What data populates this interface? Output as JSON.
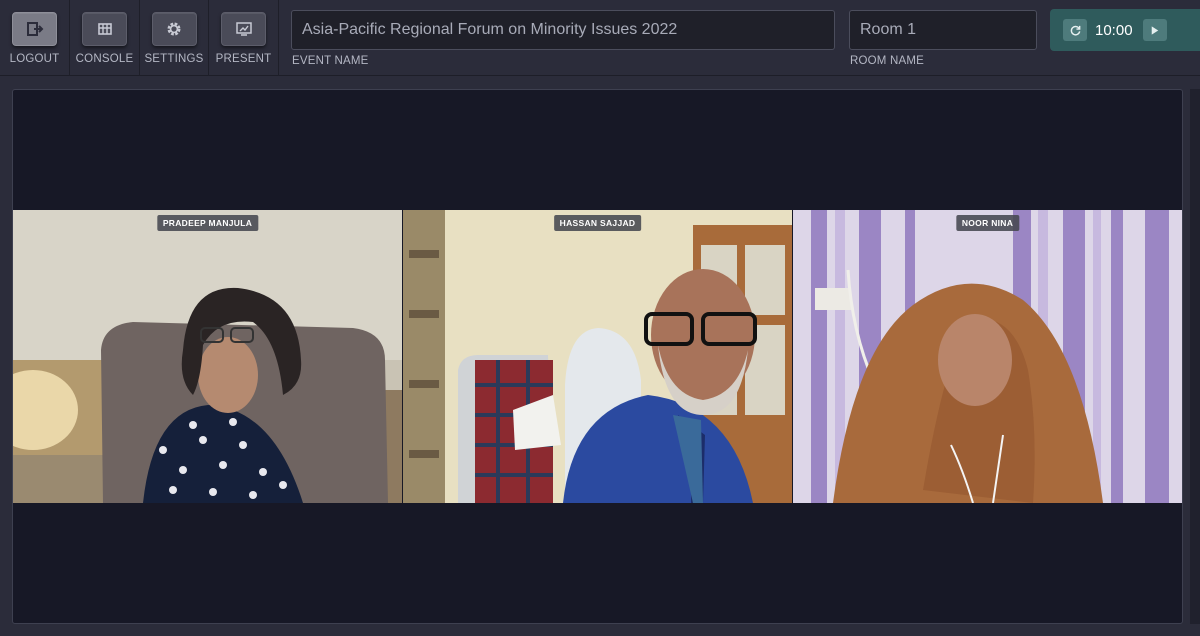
{
  "toolbar": {
    "buttons": [
      {
        "label": "LOGOUT",
        "icon": "logout-icon"
      },
      {
        "label": "CONSOLE",
        "icon": "grid-icon"
      },
      {
        "label": "SETTINGS",
        "icon": "gear-icon"
      },
      {
        "label": "PRESENT",
        "icon": "present-icon"
      }
    ],
    "event_name": {
      "value": "Asia-Pacific Regional Forum on Minority Issues 2022",
      "label": "EVENT NAME"
    },
    "room_name": {
      "value": "Room 1",
      "label": "ROOM NAME"
    },
    "timer": {
      "time": "10:00",
      "reset_icon": "refresh-icon",
      "play_icon": "play-icon"
    }
  },
  "participants": [
    {
      "name": "PRADEEP MANJULA"
    },
    {
      "name": "HASSAN SAJJAD"
    },
    {
      "name": "NOOR NINA"
    }
  ],
  "colors": {
    "background": "#2b2c3a",
    "stage": "#171826",
    "timer": "#2f5b5c",
    "accent": "#4e7b7c"
  }
}
